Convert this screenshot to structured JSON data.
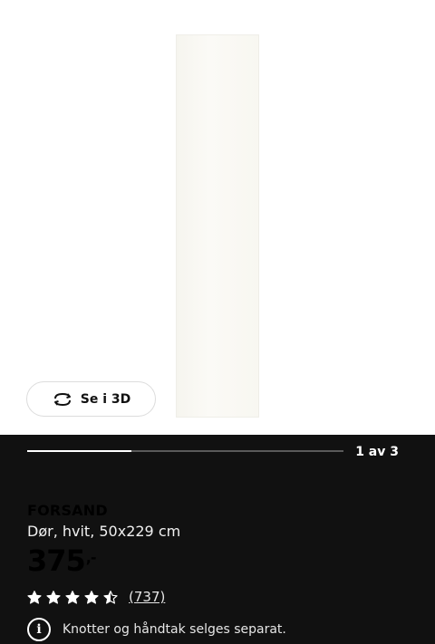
{
  "gallery": {
    "view_3d_label": "Se i 3D",
    "view_3d_icon": "rotate-3d-icon",
    "counter": "1 av 3",
    "progress_fraction": 0.33
  },
  "product": {
    "name": "FORSAND",
    "description": "Dør, hvit, 50x229 cm",
    "price": "375",
    "price_suffix": ",-",
    "rating_stars": 4.5,
    "rating_max": 5,
    "review_count": "(737)",
    "notice": "Knotter og håndtak selges separat.",
    "notice_icon": "info-icon"
  },
  "colors": {
    "panel_bg": "#111111",
    "text": "#ffffff"
  }
}
